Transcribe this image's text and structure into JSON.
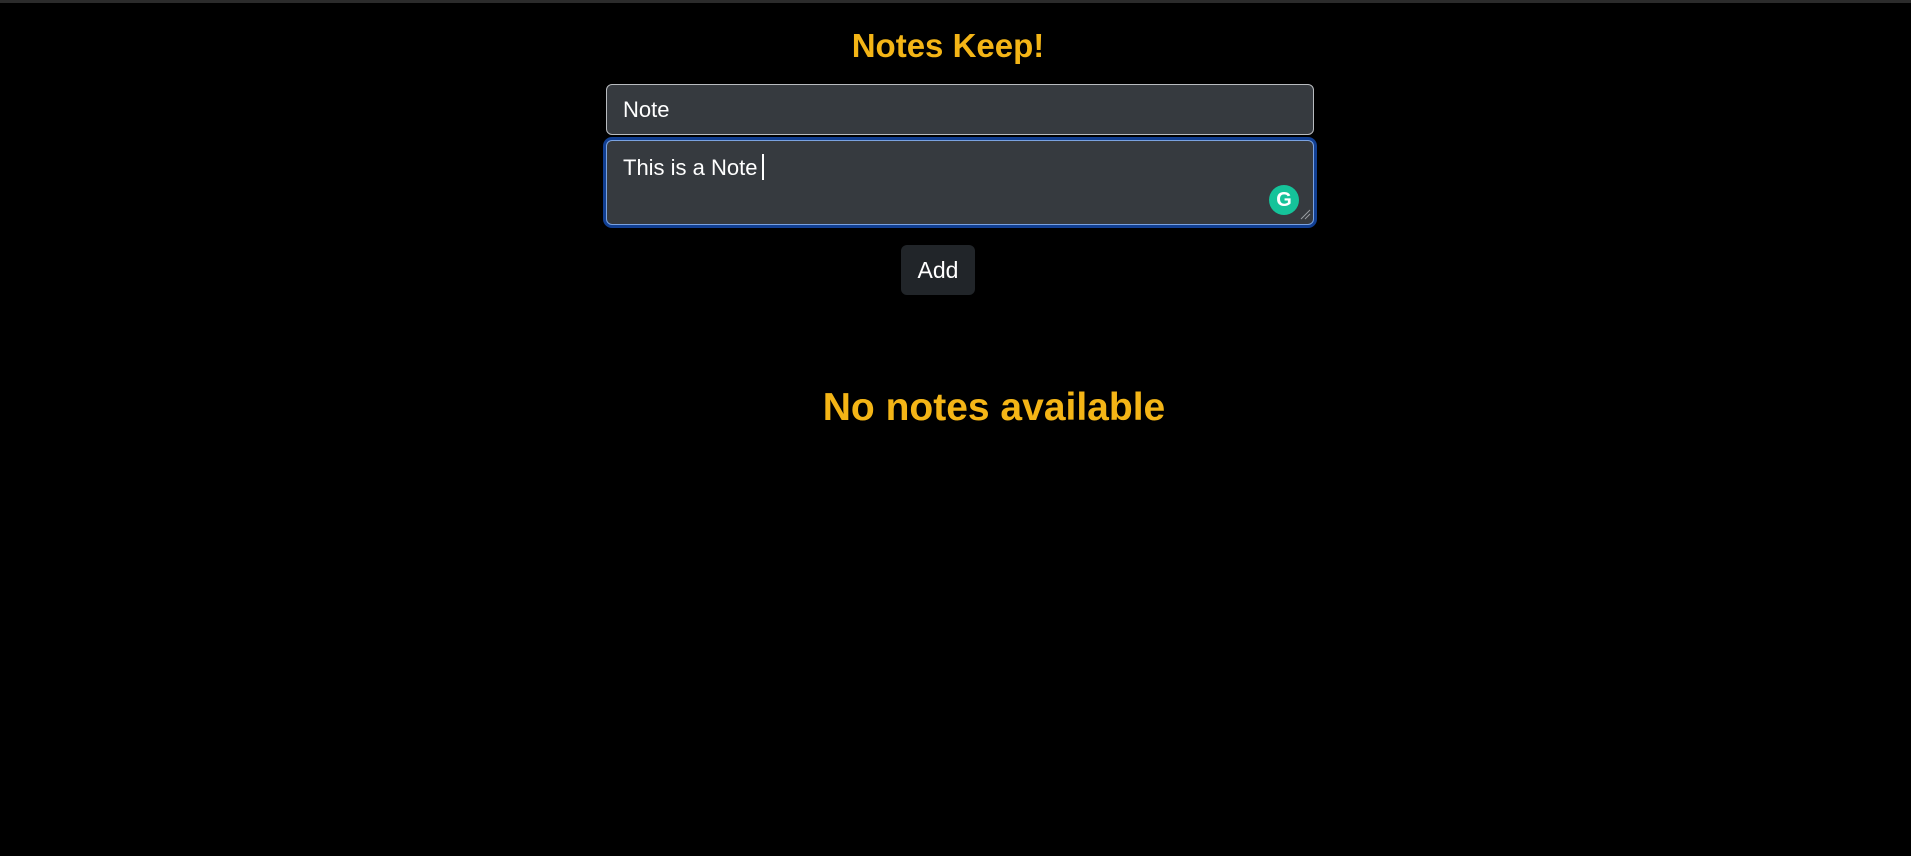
{
  "app": {
    "title": "Notes Keep!"
  },
  "form": {
    "title_value": "Note",
    "body_value": "This is a Note",
    "add_label": "Add"
  },
  "notes": {
    "empty_message": "No notes available"
  },
  "icons": {
    "grammarly": "grammarly-icon",
    "resize": "resize-handle-icon"
  },
  "colors": {
    "background": "#000000",
    "accent": "#f4b516",
    "field_background": "#363a3f",
    "focus_ring": "#1754c4",
    "button_background": "#212529",
    "grammarly": "#15c39a"
  }
}
